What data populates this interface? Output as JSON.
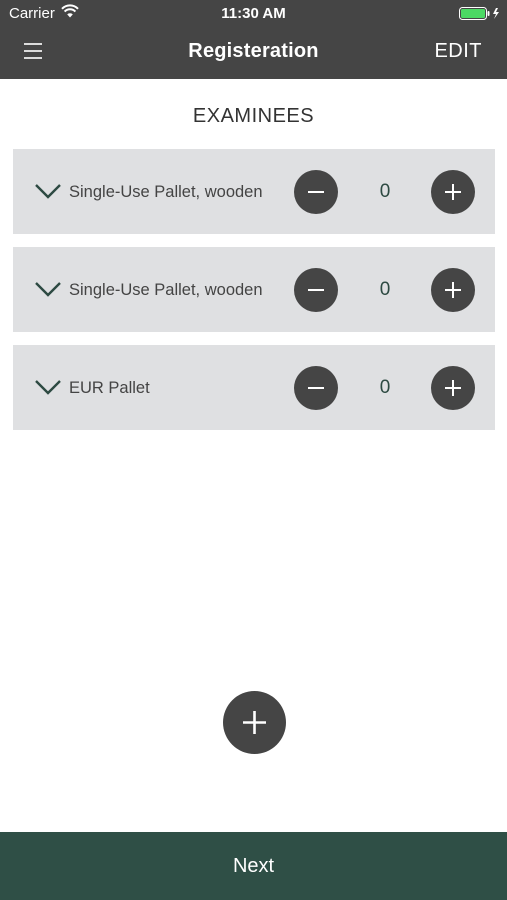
{
  "status_bar": {
    "carrier": "Carrier",
    "time": "11:30 AM"
  },
  "nav": {
    "title": "Registeration",
    "edit_label": "EDIT"
  },
  "section": {
    "title": "EXAMINEES"
  },
  "items": [
    {
      "label": "Single-Use Pallet, wooden",
      "quantity": "0"
    },
    {
      "label": "Single-Use Pallet, wooden",
      "quantity": "0"
    },
    {
      "label": "EUR Pallet",
      "quantity": "0"
    }
  ],
  "footer": {
    "next_label": "Next"
  },
  "colors": {
    "header_bg": "#454545",
    "item_bg": "#dfe0e2",
    "accent_dark_green": "#2f4f46",
    "chevron": "#2d4a42",
    "battery": "#4cd964"
  },
  "icons": {
    "menu": "hamburger-icon",
    "expand": "chevron-down-icon",
    "decrement": "minus-icon",
    "increment": "plus-icon",
    "add": "plus-icon"
  }
}
